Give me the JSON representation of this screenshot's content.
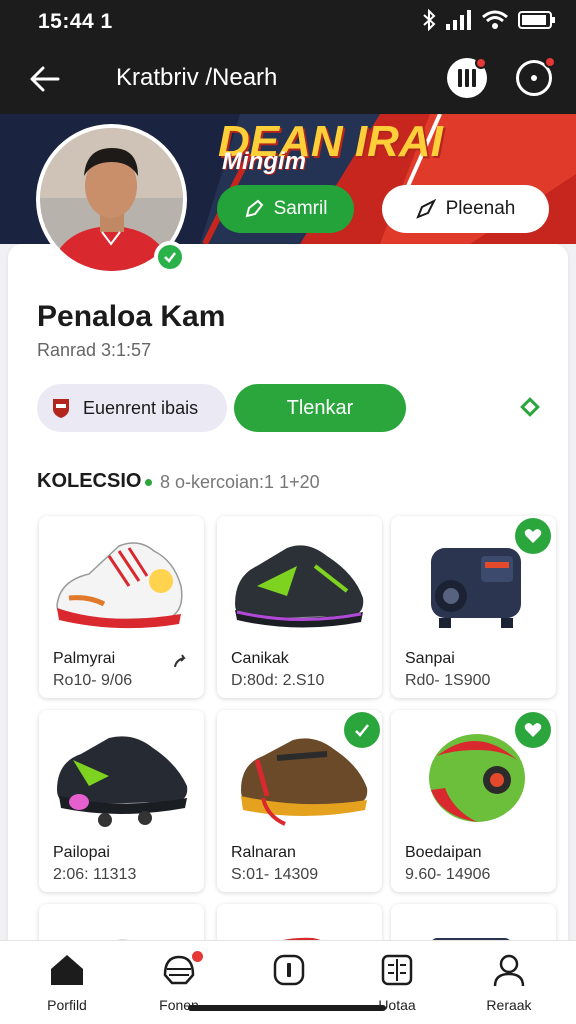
{
  "status_bar": {
    "time": "15:44 1"
  },
  "app_bar": {
    "title": "Kratbriv /Nearh"
  },
  "banner": {
    "title": "DEAN IRAI",
    "subtitle": "Mingim",
    "primary_button": "Samril",
    "secondary_button": "Pleenah"
  },
  "profile": {
    "name": "Penaloa Kam",
    "subtitle": "Ranrad 3:1:57",
    "team_chip": "Euenrent ibais",
    "follow_button": "Tlenkar"
  },
  "collection": {
    "title": "KOLECSIO",
    "meta": "8 o-kercoian:1 1+20",
    "items": [
      {
        "name": "Palmyrai",
        "price": "Ro10- 9/06"
      },
      {
        "name": "Canikak",
        "price": "D:80d: 2.S10"
      },
      {
        "name": "Sanpai",
        "price": "Rd0- 1S900"
      },
      {
        "name": "Pailopai",
        "price": "2:06: 11313"
      },
      {
        "name": "Ralnaran",
        "price": "S:01- 14309"
      },
      {
        "name": "Boedaipan",
        "price": "9.60- 14906"
      }
    ]
  },
  "bottom_nav": {
    "items": [
      {
        "label": "Porfild",
        "icon": "home-icon"
      },
      {
        "label": "Fonen",
        "icon": "helmet-icon"
      },
      {
        "label": "",
        "icon": "info-icon"
      },
      {
        "label": "Uotaa",
        "icon": "scoreboard-icon"
      },
      {
        "label": "Reraak",
        "icon": "person-icon"
      }
    ]
  },
  "colors": {
    "accent_green": "#2aa63d",
    "dark_bar": "#1c1c1c",
    "badge_red": "#e53935",
    "banner_navy": "#243253"
  }
}
